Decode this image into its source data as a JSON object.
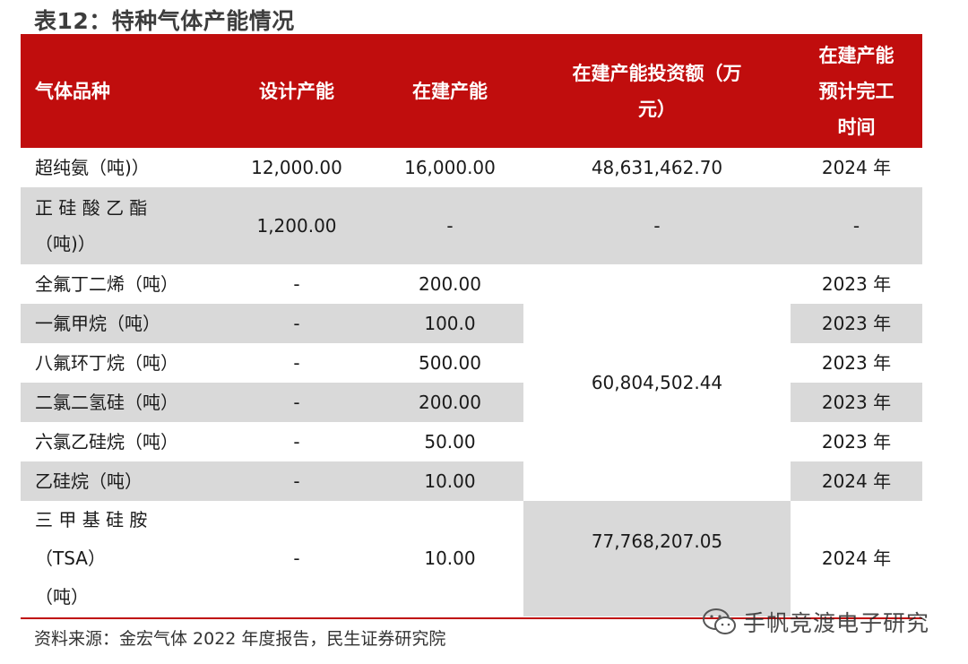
{
  "title": "表12：特种气体产能情况",
  "header": {
    "col1": "气体品种",
    "col2": "设计产能",
    "col3": "在建产能",
    "col4_line1": "在建产能投资额（万",
    "col4_line2": "元）",
    "col5_line1": "在建产能",
    "col5_line2": "预计完工",
    "col5_line3": "时间"
  },
  "rows": [
    {
      "name": "超纯氨（吨)）",
      "design": "12,000.00",
      "building": "16,000.00",
      "investment": "48,631,462.70",
      "completion": "2024 年"
    },
    {
      "name_line1": "正 硅 酸 乙 酯",
      "name_line2": "（吨)）",
      "design": "1,200.00",
      "building": "-",
      "investment": "-",
      "completion": "-"
    },
    {
      "name": "全氟丁二烯（吨）",
      "design": "-",
      "building": "200.00",
      "completion": "2023 年"
    },
    {
      "name": "一氟甲烷（吨）",
      "design": "-",
      "building": "100.0",
      "completion": "2023 年"
    },
    {
      "name": "八氟环丁烷（吨）",
      "design": "-",
      "building": "500.00",
      "completion": "2023 年"
    },
    {
      "name": "二氯二氢硅（吨）",
      "design": "-",
      "building": "200.00",
      "completion": "2023 年"
    },
    {
      "name": "六氯乙硅烷（吨）",
      "design": "-",
      "building": "50.00",
      "completion": "2023 年"
    },
    {
      "name": "乙硅烷（吨）",
      "design": "-",
      "building": "10.00",
      "completion": "2024 年"
    },
    {
      "name_line1": "三 甲 基 硅 胺",
      "name_line2": "（TSA）",
      "name_line3": "（吨）",
      "design": "-",
      "building": "10.00",
      "investment": "77,768,207.05",
      "completion": "2024 年"
    }
  ],
  "merged_investment": "60,804,502.44",
  "source": "资料来源：金宏气体 2022 年度报告，民生证券研究院",
  "watermark": "手帆竞渡电子研究",
  "colors": {
    "header_bg": "#c00d0d",
    "stripe": "#d9d9d9",
    "rule": "#c00d0d"
  }
}
